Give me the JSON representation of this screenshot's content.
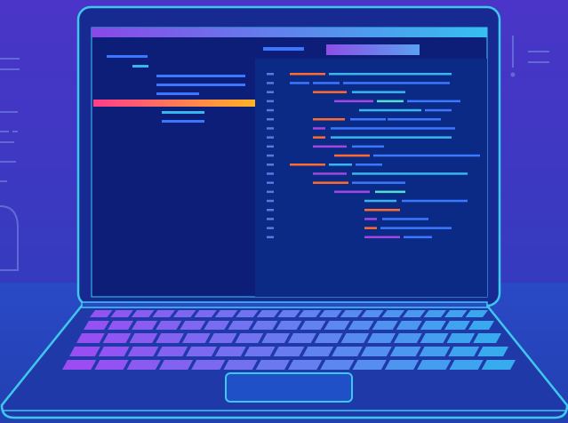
{
  "image": {
    "subject": "laptop-with-code-editor",
    "colors": {
      "background_top": "#4a35c8",
      "background_bottom": "#1f3fb0",
      "floor": "#2848c4",
      "laptop_outline": "#3ec8f0",
      "screen_bg": "#0c1e78",
      "editor_bg": "#0b2a86",
      "highlight_left": "#ff3d8b",
      "highlight_right": "#ffb224",
      "code_orange": "#ff6a2e",
      "code_purple": "#a347e0",
      "code_blue": "#3b78ff",
      "code_cyan": "#38b6f0",
      "code_teal": "#4fe0d0",
      "key_left": "#9b4cf2",
      "key_right": "#2fb2ee"
    }
  }
}
